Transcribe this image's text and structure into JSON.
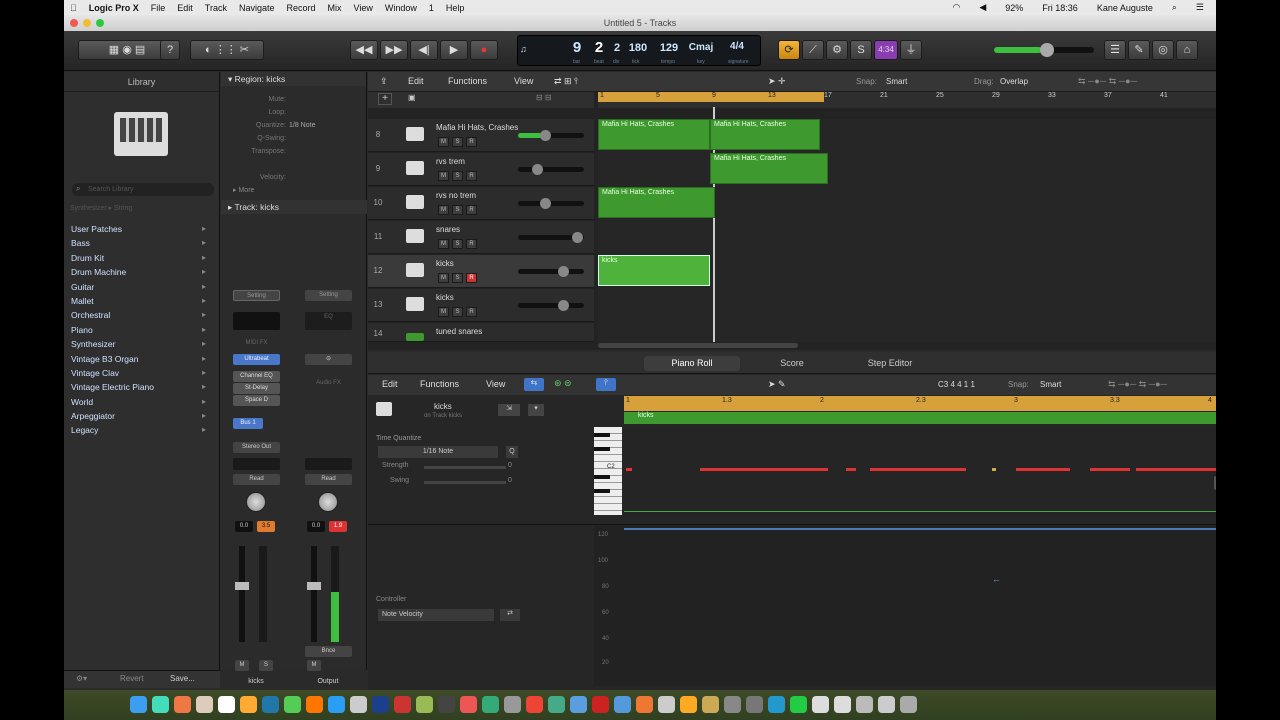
{
  "menubar": {
    "app": "Logic Pro X",
    "items": [
      "File",
      "Edit",
      "Track",
      "Navigate",
      "Record",
      "Mix",
      "View",
      "Window",
      "1",
      "Help"
    ],
    "battery": "92%",
    "clock": "Fri 18:36",
    "user": "Kane Auguste"
  },
  "window": {
    "title": "Untitled 5 - Tracks"
  },
  "lcd": {
    "bar": "9",
    "beat": "2",
    "div": "2",
    "tick": "180",
    "bpm": "129",
    "key": "Cmaj",
    "sig": "4/4",
    "lbl_bar": "bar",
    "lbl_beat": "beat",
    "lbl_div": "div",
    "lbl_tick": "tick",
    "lbl_tempo": "tempo",
    "lbl_key": "key",
    "lbl_sig": "signature",
    "count": "4:34"
  },
  "library": {
    "title": "Library",
    "search": "Search Library",
    "filters": [
      "Synthesizer",
      "String"
    ],
    "items": [
      "User Patches",
      "Bass",
      "Drum Kit",
      "Drum Machine",
      "Guitar",
      "Mallet",
      "Orchestral",
      "Piano",
      "Synthesizer",
      "Vintage B3 Organ",
      "Vintage Clav",
      "Vintage Electric Piano",
      "World",
      "Arpeggiator",
      "Legacy"
    ]
  },
  "inspector": {
    "region_header": "Region: kicks",
    "rows": [
      {
        "label": "Mute:",
        "value": ""
      },
      {
        "label": "Loop:",
        "value": ""
      },
      {
        "label": "Quantize:",
        "value": "1/8 Note"
      },
      {
        "label": "Q-Swing:",
        "value": ""
      },
      {
        "label": "Transpose:",
        "value": ""
      },
      {
        "label": "Velocity:",
        "value": ""
      }
    ],
    "more": "More",
    "track_header": "Track: kicks"
  },
  "strips": {
    "left": {
      "setting": "Setting",
      "eq": "",
      "midi_fx": "MIDI FX",
      "instrument": "Ultrabeat",
      "fx": [
        "Channel EQ",
        "St-Delay",
        "Space D"
      ],
      "send": "Bus 1",
      "output": "Stereo Out",
      "mode": "Read",
      "vol": "0.0",
      "pan": "3.5",
      "name": "kicks"
    },
    "right": {
      "setting": "Setting",
      "eq": "EQ",
      "audio_fx": "Audio FX",
      "output": "Read",
      "vol": "0.0",
      "pan": "1.9",
      "bnc": "Bnce",
      "name": "Output"
    },
    "m": "M",
    "s": "S"
  },
  "tracks_menu": {
    "edit": "Edit",
    "functions": "Functions",
    "view": "View",
    "snap_label": "Snap:",
    "snap": "Smart",
    "drag_label": "Drag:",
    "drag": "Overlap"
  },
  "ruler": [
    "1",
    "5",
    "9",
    "13",
    "17",
    "21",
    "25",
    "29",
    "33",
    "37",
    "41"
  ],
  "tracks": [
    {
      "num": "8",
      "name": "Mafia Hi Hats, Crashes"
    },
    {
      "num": "9",
      "name": "rvs trem"
    },
    {
      "num": "10",
      "name": "rvs no trem"
    },
    {
      "num": "11",
      "name": "snares"
    },
    {
      "num": "12",
      "name": "kicks"
    },
    {
      "num": "13",
      "name": "kicks"
    },
    {
      "num": "14",
      "name": "tuned snares"
    }
  ],
  "regions": [
    {
      "label": "Mafia Hi Hats, Crashes"
    },
    {
      "label": "Mafia Hi Hats, Crashes"
    },
    {
      "label": "Mafia Hi Hats, Crashes"
    },
    {
      "label": "Mafia Hi Hats, Crashes"
    },
    {
      "label": "kicks"
    }
  ],
  "editor": {
    "tabs": [
      "Piano Roll",
      "Score",
      "Step Editor"
    ],
    "edit": "Edit",
    "functions": "Functions",
    "view": "View",
    "position": "C3 4 4 1 1",
    "snap_label": "Snap:",
    "snap": "Smart",
    "region": "kicks",
    "sub": "on Track kicks",
    "tq_label": "Time Quantize",
    "tq": "1/16 Note",
    "q": "Q",
    "strength": "Strength",
    "strength_v": "0",
    "swing": "Swing",
    "swing_v": "0",
    "c2": "C2",
    "controller_label": "Controller",
    "controller": "Note Velocity",
    "ruler": [
      "1",
      "1.3",
      "2",
      "2.3",
      "3",
      "3.3",
      "4"
    ],
    "vel_axis": [
      "120",
      "100",
      "80",
      "60",
      "40",
      "20"
    ]
  },
  "footer": {
    "revert": "Revert",
    "save": "Save..."
  }
}
